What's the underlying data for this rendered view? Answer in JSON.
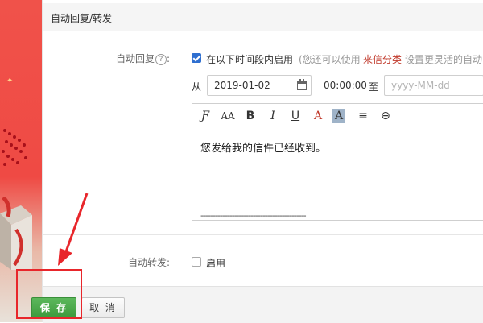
{
  "dialog": {
    "title": "自动回复/转发"
  },
  "auto_reply": {
    "label": "自动回复",
    "help_icon_glyph": "?",
    "colon": ":",
    "enable_label": "在以下时间段内启用",
    "hint_prefix": "(您还可以使用",
    "hint_link": "来信分类",
    "hint_suffix": "设置更灵活的自动",
    "from_label": "从",
    "start_date": "2019-01-02",
    "start_time": "00:00:00",
    "to_label": "至",
    "end_date_placeholder": "yyyy-MM-dd",
    "enabled": true
  },
  "editor": {
    "toolbar": {
      "font": "Ƒ",
      "font_size": "AA",
      "bold": "B",
      "italic": "I",
      "underline": "U",
      "text_color": "A",
      "bg_color": "A",
      "align": "≡",
      "link": "⊖"
    },
    "body_text": "您发给我的信件已经收到。",
    "signature_line": "--------------------------------------------"
  },
  "auto_forward": {
    "label": "自动转发:",
    "enable_label": "启用",
    "enabled": false
  },
  "footer": {
    "save_label": "保 存",
    "cancel_label": "取 消"
  },
  "colors": {
    "accent_green": "#4cae4c",
    "link_red": "#c0392b",
    "annotation_red": "#e8262b",
    "checkbox_blue": "#2f6fd0"
  }
}
